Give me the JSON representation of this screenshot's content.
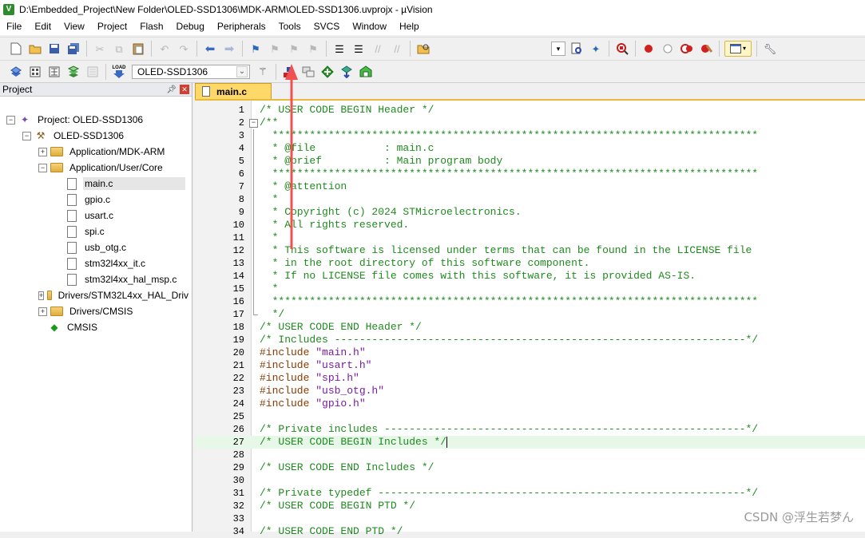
{
  "window": {
    "title": "D:\\Embedded_Project\\New Folder\\OLED-SSD1306\\MDK-ARM\\OLED-SSD1306.uvprojx - µVision",
    "app_icon": "V"
  },
  "menu": [
    "File",
    "Edit",
    "View",
    "Project",
    "Flash",
    "Debug",
    "Peripherals",
    "Tools",
    "SVCS",
    "Window",
    "Help"
  ],
  "toolbar": {
    "target_name": "OLED-SSD1306",
    "load_label": "LOAD"
  },
  "project_panel": {
    "title": "Project",
    "items": [
      {
        "label": "Project: OLED-SSD1306"
      },
      {
        "label": "OLED-SSD1306"
      },
      {
        "label": "Application/MDK-ARM"
      },
      {
        "label": "Application/User/Core"
      },
      {
        "label": "main.c"
      },
      {
        "label": "gpio.c"
      },
      {
        "label": "usart.c"
      },
      {
        "label": "spi.c"
      },
      {
        "label": "usb_otg.c"
      },
      {
        "label": "stm32l4xx_it.c"
      },
      {
        "label": "stm32l4xx_hal_msp.c"
      },
      {
        "label": "Drivers/STM32L4xx_HAL_Driv"
      },
      {
        "label": "Drivers/CMSIS"
      },
      {
        "label": "CMSIS"
      }
    ]
  },
  "editor": {
    "tab_label": "main.c",
    "lines": [
      {
        "n": "1",
        "text": "/* USER CODE BEGIN Header */"
      },
      {
        "n": "2",
        "text": "/**"
      },
      {
        "n": "3",
        "text": "  ******************************************************************************"
      },
      {
        "n": "4",
        "text": "  * @file           : main.c"
      },
      {
        "n": "5",
        "text": "  * @brief          : Main program body"
      },
      {
        "n": "6",
        "text": "  ******************************************************************************"
      },
      {
        "n": "7",
        "text": "  * @attention"
      },
      {
        "n": "8",
        "text": "  *"
      },
      {
        "n": "9",
        "text": "  * Copyright (c) 2024 STMicroelectronics."
      },
      {
        "n": "10",
        "text": "  * All rights reserved."
      },
      {
        "n": "11",
        "text": "  *"
      },
      {
        "n": "12",
        "text": "  * This software is licensed under terms that can be found in the LICENSE file"
      },
      {
        "n": "13",
        "text": "  * in the root directory of this software component."
      },
      {
        "n": "14",
        "text": "  * If no LICENSE file comes with this software, it is provided AS-IS."
      },
      {
        "n": "15",
        "text": "  *"
      },
      {
        "n": "16",
        "text": "  ******************************************************************************"
      },
      {
        "n": "17",
        "text": "  */"
      },
      {
        "n": "18",
        "text": "/* USER CODE END Header */"
      },
      {
        "n": "19",
        "text": "/* Includes ------------------------------------------------------------------*/"
      },
      {
        "n": "20",
        "kw": "#include ",
        "str": "\"main.h\""
      },
      {
        "n": "21",
        "kw": "#include ",
        "str": "\"usart.h\""
      },
      {
        "n": "22",
        "kw": "#include ",
        "str": "\"spi.h\""
      },
      {
        "n": "23",
        "kw": "#include ",
        "str": "\"usb_otg.h\""
      },
      {
        "n": "24",
        "kw": "#include ",
        "str": "\"gpio.h\""
      },
      {
        "n": "25",
        "text": ""
      },
      {
        "n": "26",
        "text": "/* Private includes ----------------------------------------------------------*/"
      },
      {
        "n": "27",
        "text": "/* USER CODE BEGIN Includes */"
      },
      {
        "n": "28",
        "text": ""
      },
      {
        "n": "29",
        "text": "/* USER CODE END Includes */"
      },
      {
        "n": "30",
        "text": ""
      },
      {
        "n": "31",
        "text": "/* Private typedef -----------------------------------------------------------*/"
      },
      {
        "n": "32",
        "text": "/* USER CODE BEGIN PTD */"
      },
      {
        "n": "33",
        "text": ""
      },
      {
        "n": "34",
        "text": "/* USER CODE END PTD */"
      }
    ]
  },
  "watermark": "CSDN @浮生若梦ん"
}
